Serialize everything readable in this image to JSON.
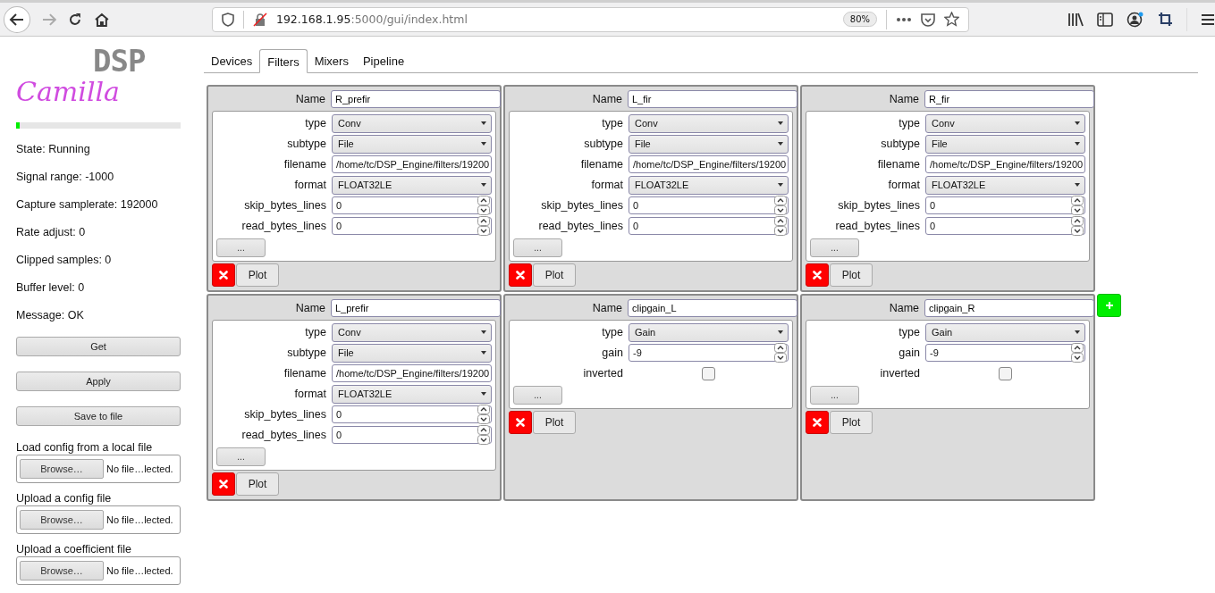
{
  "browser": {
    "url_host": "192.168.1.95",
    "url_rest": ":5000/gui/index.html",
    "zoom": "80%"
  },
  "logo": {
    "script": "Camilla",
    "pixel": "DSP"
  },
  "signal": {
    "level": 0.02
  },
  "status": [
    "State: Running",
    "Signal range: -1000",
    "Capture samplerate: 192000",
    "Rate adjust: 0",
    "Clipped samples: 0",
    "Buffer level: 0",
    "Message: OK"
  ],
  "actions": [
    "Get",
    "Apply",
    "Save to file"
  ],
  "uploads": [
    {
      "label": "Load config from a local file",
      "button": "Browse…",
      "status": "No file…lected."
    },
    {
      "label": "Upload a config file",
      "button": "Browse…",
      "status": "No file…lected."
    },
    {
      "label": "Upload a coefficient file",
      "button": "Browse…",
      "status": "No file…lected."
    }
  ],
  "tabs": [
    {
      "label": "Devices",
      "selected": false
    },
    {
      "label": "Filters",
      "selected": true
    },
    {
      "label": "Mixers",
      "selected": false
    },
    {
      "label": "Pipeline",
      "selected": false
    }
  ],
  "filters": [
    {
      "name_label": "Name",
      "name": "R_prefir",
      "more": "...",
      "plot": "Plot",
      "params": [
        {
          "label": "type",
          "kind": "select",
          "value": "Conv"
        },
        {
          "label": "subtype",
          "kind": "select",
          "value": "File"
        },
        {
          "label": "filename",
          "kind": "text",
          "value": "/home/tc/DSP_Engine/filters/19200"
        },
        {
          "label": "format",
          "kind": "select",
          "value": "FLOAT32LE"
        },
        {
          "label": "skip_bytes_lines",
          "kind": "number",
          "value": "0"
        },
        {
          "label": "read_bytes_lines",
          "kind": "number",
          "value": "0"
        }
      ]
    },
    {
      "name_label": "Name",
      "name": "L_fir",
      "more": "...",
      "plot": "Plot",
      "params": [
        {
          "label": "type",
          "kind": "select",
          "value": "Conv"
        },
        {
          "label": "subtype",
          "kind": "select",
          "value": "File"
        },
        {
          "label": "filename",
          "kind": "text",
          "value": "/home/tc/DSP_Engine/filters/19200"
        },
        {
          "label": "format",
          "kind": "select",
          "value": "FLOAT32LE"
        },
        {
          "label": "skip_bytes_lines",
          "kind": "number",
          "value": "0"
        },
        {
          "label": "read_bytes_lines",
          "kind": "number",
          "value": "0"
        }
      ]
    },
    {
      "name_label": "Name",
      "name": "R_fir",
      "more": "...",
      "plot": "Plot",
      "params": [
        {
          "label": "type",
          "kind": "select",
          "value": "Conv"
        },
        {
          "label": "subtype",
          "kind": "select",
          "value": "File"
        },
        {
          "label": "filename",
          "kind": "text",
          "value": "/home/tc/DSP_Engine/filters/19200"
        },
        {
          "label": "format",
          "kind": "select",
          "value": "FLOAT32LE"
        },
        {
          "label": "skip_bytes_lines",
          "kind": "number",
          "value": "0"
        },
        {
          "label": "read_bytes_lines",
          "kind": "number",
          "value": "0"
        }
      ]
    },
    {
      "name_label": "Name",
      "name": "L_prefir",
      "more": "...",
      "plot": "Plot",
      "params": [
        {
          "label": "type",
          "kind": "select",
          "value": "Conv"
        },
        {
          "label": "subtype",
          "kind": "select",
          "value": "File"
        },
        {
          "label": "filename",
          "kind": "text",
          "value": "/home/tc/DSP_Engine/filters/19200"
        },
        {
          "label": "format",
          "kind": "select",
          "value": "FLOAT32LE"
        },
        {
          "label": "skip_bytes_lines",
          "kind": "number",
          "value": "0"
        },
        {
          "label": "read_bytes_lines",
          "kind": "number",
          "value": "0"
        }
      ]
    },
    {
      "name_label": "Name",
      "name": "clipgain_L",
      "more": "...",
      "plot": "Plot",
      "params": [
        {
          "label": "type",
          "kind": "select",
          "value": "Gain"
        },
        {
          "label": "gain",
          "kind": "number",
          "value": "-9"
        },
        {
          "label": "inverted",
          "kind": "checkbox",
          "checked": false
        }
      ]
    },
    {
      "name_label": "Name",
      "name": "clipgain_R",
      "more": "...",
      "plot": "Plot",
      "params": [
        {
          "label": "type",
          "kind": "select",
          "value": "Gain"
        },
        {
          "label": "gain",
          "kind": "number",
          "value": "-9"
        },
        {
          "label": "inverted",
          "kind": "checkbox",
          "checked": false
        }
      ]
    }
  ]
}
